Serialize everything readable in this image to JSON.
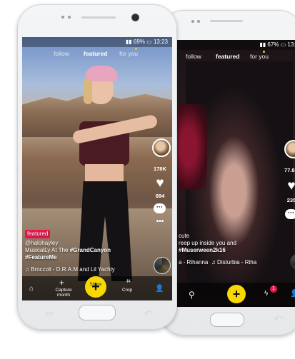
{
  "left_phone": {
    "status": {
      "battery": "69%",
      "time": "13:23"
    },
    "tabs": {
      "follow": "follow",
      "featured": "featured",
      "for_you": "for you"
    },
    "rail": {
      "likes": "178K",
      "comments": "684"
    },
    "caption": {
      "badge": "featured",
      "user": "@halohayley",
      "text_prefix": "MusicalLy At The ",
      "hashtag1": "#GrandCanyon",
      "hashtag2": "#FeatureMe",
      "sound": "Broccoli - D.R.A.M and Lil Yachty"
    },
    "bottom": {
      "capture": "Capture month",
      "share": "Share",
      "crop": "Crop"
    }
  },
  "right_phone": {
    "status": {
      "battery": "67%",
      "time": "13:2"
    },
    "tabs": {
      "follow": "follow",
      "featured": "featured",
      "for_you": "for you"
    },
    "rail": {
      "likes": "77.8K",
      "comments": "235"
    },
    "caption": {
      "line1": "cute",
      "line2": "reep up inside you and",
      "hashtag": "#Muserween2k16",
      "sound_a": "a - Rihanna",
      "sound_b": "Disturbia - Riha"
    },
    "bottom": {
      "notif_count": "1"
    }
  }
}
